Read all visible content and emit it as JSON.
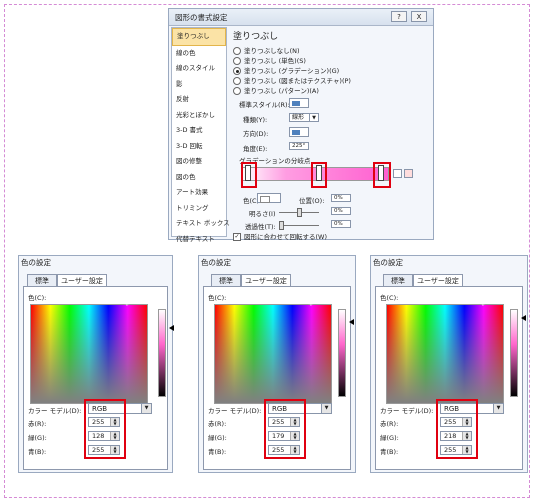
{
  "format_dialog": {
    "title": "図形の書式設定",
    "help": "?",
    "close": "X",
    "nav": [
      "塗りつぶし",
      "線の色",
      "線のスタイル",
      "影",
      "反射",
      "光彩とぼかし",
      "3-D 書式",
      "3-D 回転",
      "図の修整",
      "図の色",
      "アート効果",
      "トリミング",
      "テキスト ボックス",
      "代替テキスト"
    ],
    "heading": "塗りつぶし",
    "fill_options": [
      "塗りつぶしなし(N)",
      "塗りつぶし (単色)(S)",
      "塗りつぶし (グラデーション)(G)",
      "塗りつぶし (図またはテクスチャ)(P)",
      "塗りつぶし (パターン)(A)"
    ],
    "selected_fill": 2,
    "preset_label": "標準スタイル(R):",
    "type_label": "種類(Y):",
    "type_value": "線形",
    "direction_label": "方向(D):",
    "angle_label": "角度(E):",
    "angle_value": "225°",
    "stops_label": "グラデーションの分岐点",
    "color_label": "色(C)",
    "position_label": "位置(O):",
    "position_value": "0%",
    "brightness_label": "明るさ(I)",
    "brightness_value": "0%",
    "transparency_label": "透過性(T):",
    "transparency_value": "0%",
    "rotate_label": "図形に合わせて回転する(W)",
    "accent_color": "#e00010"
  },
  "color_dialogs": [
    {
      "title": "色の設定",
      "tab_standard": "標準",
      "tab_custom": "ユーザー設定",
      "color_label": "色(C):",
      "model_label": "カラー モデル(D):",
      "model": "RGB",
      "red_label": "赤(R):",
      "green_label": "緑(G):",
      "blue_label": "青(B):",
      "red": "255",
      "green": "128",
      "blue": "255"
    },
    {
      "title": "色の設定",
      "tab_standard": "標準",
      "tab_custom": "ユーザー設定",
      "color_label": "色(C):",
      "model_label": "カラー モデル(D):",
      "model": "RGB",
      "red_label": "赤(R):",
      "green_label": "緑(G):",
      "blue_label": "青(B):",
      "red": "255",
      "green": "179",
      "blue": "255"
    },
    {
      "title": "色の設定",
      "tab_standard": "標準",
      "tab_custom": "ユーザー設定",
      "color_label": "色(C):",
      "model_label": "カラー モデル(D):",
      "model": "RGB",
      "red_label": "赤(R):",
      "green_label": "緑(G):",
      "blue_label": "青(B):",
      "red": "255",
      "green": "218",
      "blue": "255"
    }
  ]
}
